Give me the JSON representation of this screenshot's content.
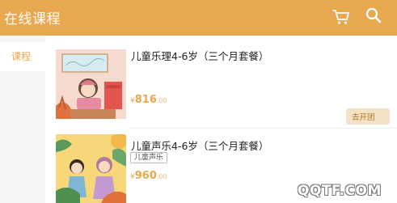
{
  "header": {
    "title": "在线课程",
    "cart_icon": "cart-icon",
    "search_icon": "search-icon",
    "background": "#e8a84f"
  },
  "sidebar": {
    "items": [
      {
        "label": "课程",
        "active": true
      }
    ]
  },
  "courses": [
    {
      "title": "儿童乐理4-6岁（三个月套餐）",
      "price_symbol": "¥",
      "price_int": "816",
      "price_dec": ".00",
      "action_label": "去开团"
    },
    {
      "title": "儿童声乐4-6岁（三个月套餐）",
      "tag": "儿童声乐",
      "price_symbol": "¥",
      "price_int": "960",
      "price_dec": ".00"
    }
  ],
  "colors": {
    "accent": "#e8a84f",
    "price": "#e8a84f",
    "button_bg": "#f4e2c6"
  },
  "watermark": "QQTF.COM"
}
